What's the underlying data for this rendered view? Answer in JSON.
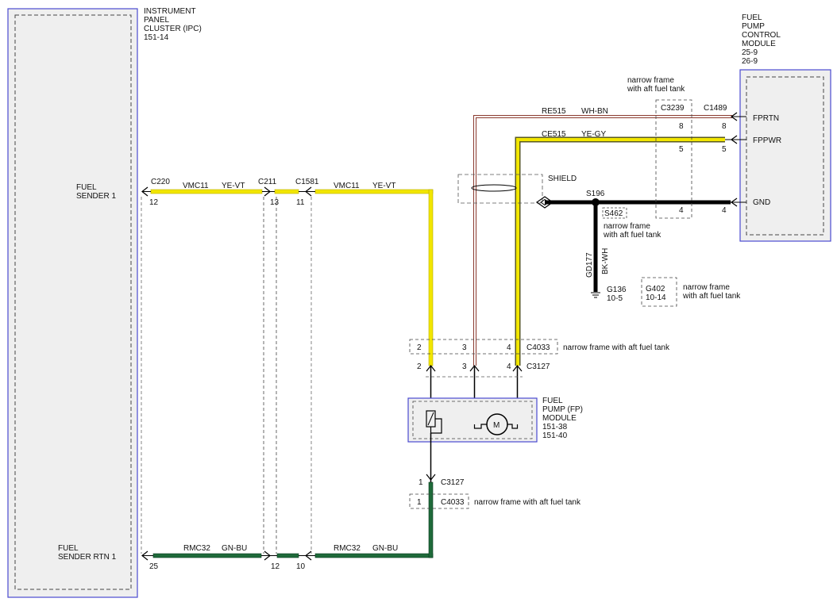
{
  "colors": {
    "module_border": "#4a4ad0",
    "module_fill": "#efefef",
    "wire_yellow": "#f2e600",
    "wire_ye_gy": "#f2e600",
    "wire_green": "#1f6a3a",
    "wire_blue_stripe": "#1c2fa0",
    "wire_white_brown": "#8b3a2f",
    "wire_black": "#000000"
  },
  "modules": {
    "ipc": {
      "line1": "INSTRUMENT",
      "line2": "PANEL",
      "line3": "CLUSTER (IPC)",
      "line4": "151-14"
    },
    "fpcm": {
      "line1": "FUEL",
      "line2": "PUMP",
      "line3": "CONTROL",
      "line4": "MODULE",
      "line5": "25-9",
      "line6": "26-9"
    },
    "fp": {
      "line1": "FUEL",
      "line2": "PUMP (FP)",
      "line3": "MODULE",
      "line4": "151-38",
      "line5": "151-40",
      "motor_symbol": "M"
    }
  },
  "pins": {
    "fuel_sender_1": {
      "line1": "FUEL",
      "line2": "SENDER 1"
    },
    "fuel_sender_rtn_1": {
      "line1": "FUEL",
      "line2": "SENDER RTN 1"
    },
    "fprtn": "FPRTN",
    "fppwr": "FPPWR",
    "gnd": "GND"
  },
  "connectors": {
    "c220": "C220",
    "c220_pin": "12",
    "c220_pin_rtn": "25",
    "c211": "C211",
    "c211_pin": "13",
    "c211_pin_rtn": "12",
    "c1581": "C1581",
    "c1581_pin": "11",
    "c1581_pin_rtn": "10",
    "c3239": "C3239",
    "c3239_pin_8": "8",
    "c3239_pin_5": "5",
    "c3239_pin_4": "4",
    "c1489": "C1489",
    "c1489_pin_8": "8",
    "c1489_pin_5": "5",
    "c1489_pin_4": "4",
    "c4033": "C4033",
    "c4033_pin_2": "2",
    "c4033_pin_3": "3",
    "c4033_pin_4": "4",
    "c3127": "C3127",
    "c3127_pin_2": "2",
    "c3127_pin_3": "3",
    "c3127_pin_4": "4",
    "c3127_lower": "C3127",
    "c3127_lower_pin": "1",
    "c4033_lower": "C4033",
    "c4033_lower_pin": "1"
  },
  "circuits": {
    "vmc11": "VMC11",
    "ye_vt": "YE-VT",
    "rmc32": "RMC32",
    "gn_bu": "GN-BU",
    "re515": "RE515",
    "wh_bn": "WH-BN",
    "ce515": "CE515",
    "ye_gy": "YE-GY",
    "gd177": "GD177",
    "bk_wh": "BK-WH"
  },
  "splices": {
    "s196": "S196",
    "s462": "S462",
    "shield": "SHIELD"
  },
  "grounds": {
    "g136": "G136",
    "g136_ref": "10-5",
    "g402": "G402",
    "g402_ref": "10-14"
  },
  "notes": {
    "narrow_frame_line1": "narrow frame",
    "narrow_frame_line2": "with aft fuel tank",
    "narrow_frame_full": "narrow frame with aft fuel tank"
  }
}
